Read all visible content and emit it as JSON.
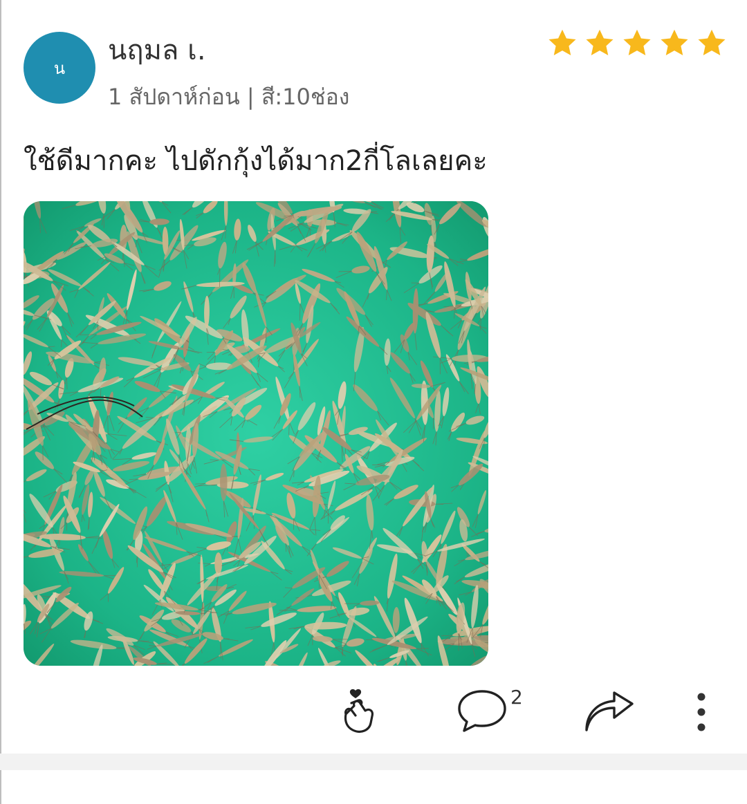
{
  "review": {
    "avatar_letter": "น",
    "username": "นฤมล เ.",
    "meta": "1 สัปดาห์ก่อน | สี:10ช่อง",
    "rating": 5,
    "text": "ใช้ดีมากคะ ไปดักกุ้งได้มาก2กี่โลเลยคะ",
    "photo_icon": "shrimp-photo"
  },
  "actions": {
    "like_icon": "finger-heart-icon",
    "comment_icon": "comment-bubble-icon",
    "comment_count": "2",
    "share_icon": "share-arrow-icon",
    "more_icon": "more-vertical-icon"
  },
  "colors": {
    "avatar": "#1f8eb0",
    "star": "#f8b81c",
    "basin": "#1fb58e"
  }
}
